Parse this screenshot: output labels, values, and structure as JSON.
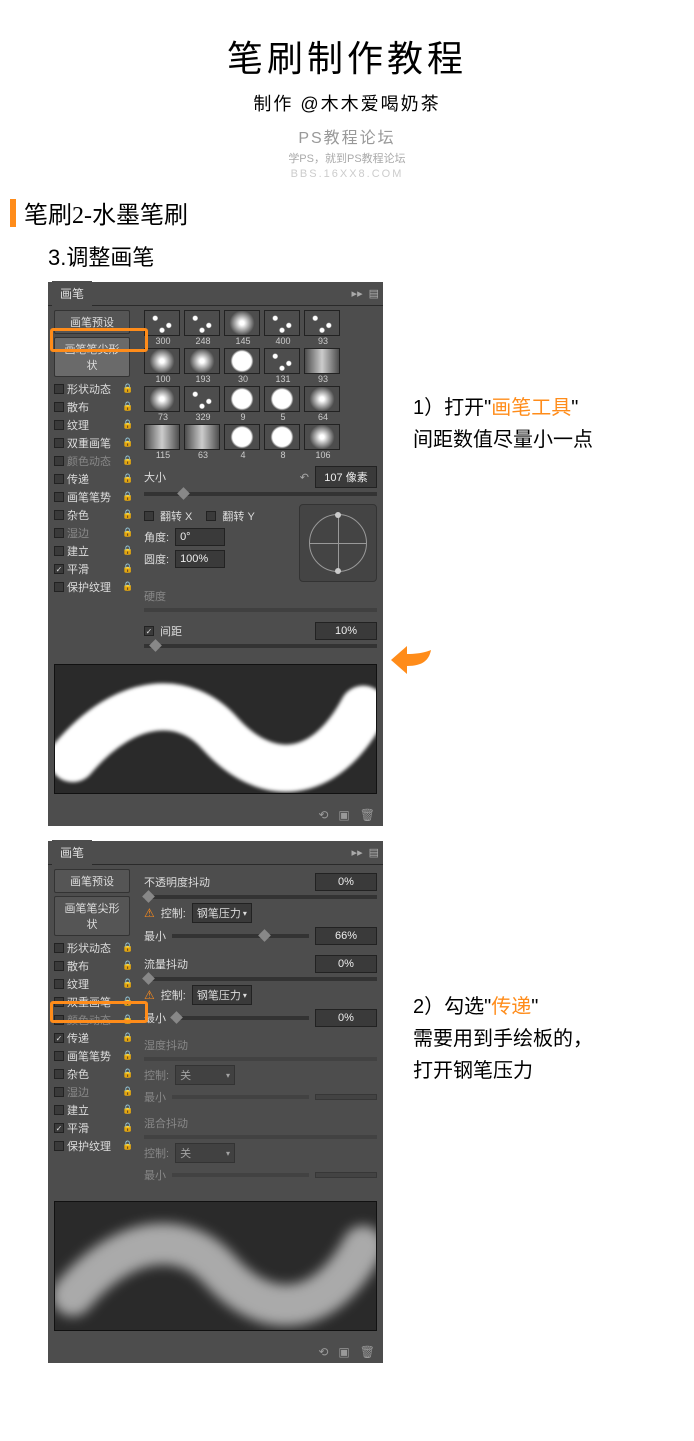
{
  "header": {
    "title": "笔刷制作教程",
    "subtitle": "制作 @木木爱喝奶茶",
    "forum": "PS教程论坛",
    "forum_sub": "学PS，就到PS教程论坛",
    "bbs": "BBS.16XX8.COM"
  },
  "section": {
    "title": "笔刷2-水墨笔刷"
  },
  "step": {
    "title": "3.调整画笔"
  },
  "panel1": {
    "tab": "画笔",
    "preset_btn": "画笔预设",
    "tip_shape_btn": "画笔笔尖形状",
    "sidebar": [
      {
        "label": "形状动态",
        "lock": true,
        "checked": false
      },
      {
        "label": "散布",
        "lock": true,
        "checked": false
      },
      {
        "label": "纹理",
        "lock": true,
        "checked": false
      },
      {
        "label": "双重画笔",
        "lock": true,
        "checked": false
      },
      {
        "label": "颜色动态",
        "lock": true,
        "checked": false,
        "dim": true
      },
      {
        "label": "传递",
        "lock": true,
        "checked": false
      },
      {
        "label": "画笔笔势",
        "lock": true,
        "checked": false
      },
      {
        "label": "杂色",
        "lock": true,
        "checked": false
      },
      {
        "label": "湿边",
        "lock": true,
        "checked": false,
        "dim": true
      },
      {
        "label": "建立",
        "lock": true,
        "checked": false
      },
      {
        "label": "平滑",
        "lock": true,
        "checked": true
      },
      {
        "label": "保护纹理",
        "lock": true,
        "checked": false
      }
    ],
    "thumbs": [
      {
        "n": "300"
      },
      {
        "n": "248"
      },
      {
        "n": "145"
      },
      {
        "n": "400"
      },
      {
        "n": "93"
      },
      {
        "n": "100"
      },
      {
        "n": "193"
      },
      {
        "n": "30"
      },
      {
        "n": "131"
      },
      {
        "n": "93"
      },
      {
        "n": "73"
      },
      {
        "n": "329"
      },
      {
        "n": "9"
      },
      {
        "n": "5"
      },
      {
        "n": "64"
      },
      {
        "n": "115"
      },
      {
        "n": "63"
      },
      {
        "n": "4"
      },
      {
        "n": "8"
      },
      {
        "n": "106"
      }
    ],
    "size_label": "大小",
    "size_val": "107 像素",
    "flipx": "翻转 X",
    "flipy": "翻转 Y",
    "angle_label": "角度:",
    "angle_val": "0°",
    "round_label": "圆度:",
    "round_val": "100%",
    "hardness_label": "硬度",
    "spacing_label": "间距",
    "spacing_val": "10%"
  },
  "panel2": {
    "tab": "画笔",
    "preset_btn": "画笔预设",
    "tip_shape_btn": "画笔笔尖形状",
    "sidebar": [
      {
        "label": "形状动态",
        "lock": true,
        "checked": false
      },
      {
        "label": "散布",
        "lock": true,
        "checked": false
      },
      {
        "label": "纹理",
        "lock": true,
        "checked": false
      },
      {
        "label": "双重画笔",
        "lock": true,
        "checked": false
      },
      {
        "label": "颜色动态",
        "lock": true,
        "checked": false,
        "dim": true
      },
      {
        "label": "传递",
        "lock": true,
        "checked": true
      },
      {
        "label": "画笔笔势",
        "lock": true,
        "checked": false
      },
      {
        "label": "杂色",
        "lock": true,
        "checked": false
      },
      {
        "label": "湿边",
        "lock": true,
        "checked": false,
        "dim": true
      },
      {
        "label": "建立",
        "lock": true,
        "checked": false
      },
      {
        "label": "平滑",
        "lock": true,
        "checked": true
      },
      {
        "label": "保护纹理",
        "lock": true,
        "checked": false
      }
    ],
    "opacity_jitter": "不透明度抖动",
    "opacity_jitter_val": "0%",
    "control": "控制:",
    "pen_pressure": "钢笔压力",
    "min": "最小",
    "min_val1": "66%",
    "min_val2": "0%",
    "flow_jitter": "流量抖动",
    "flow_jitter_val": "0%",
    "wet_jitter": "湿度抖动",
    "off": "关",
    "mix_jitter": "混合抖动",
    "warn": "⚠"
  },
  "anno1": {
    "line1_pre": "1）打开\"",
    "line1_hi": "画笔工具",
    "line1_post": "\"",
    "line2": "间距数值尽量小一点"
  },
  "anno2": {
    "line1_pre": "2）勾选\"",
    "line1_hi": "传递",
    "line1_post": "\"",
    "line2": "需要用到手绘板的，",
    "line3": "打开钢笔压力"
  }
}
